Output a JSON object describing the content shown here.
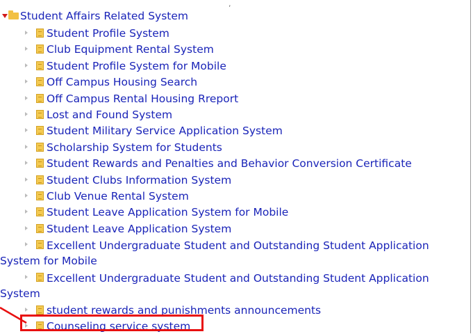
{
  "tree": {
    "root_label": "Student Affairs Related System",
    "items": [
      {
        "label": "Student Profile System"
      },
      {
        "label": "Club Equipment Rental System"
      },
      {
        "label": "Student Profile System for Mobile"
      },
      {
        "label": "Off Campus Housing Search"
      },
      {
        "label": "Off Campus Rental Housing Rreport"
      },
      {
        "label": "Lost and Found System"
      },
      {
        "label": "Student Military Service Application System"
      },
      {
        "label": "Scholarship System for Students"
      },
      {
        "label": "Student Rewards and Penalties and Behavior Conversion Certificate"
      },
      {
        "label": "Student Clubs Information System"
      },
      {
        "label": "Club Venue Rental System"
      },
      {
        "label": "Student Leave Application System for Mobile"
      },
      {
        "label": "Student Leave Application System"
      },
      {
        "label": "Excellent Undergraduate Student and Outstanding Student Application System for Mobile"
      },
      {
        "label": "Excellent Undergraduate Student and Outstanding Student Application System"
      },
      {
        "label": "student rewards and punishments announcements"
      },
      {
        "label": "Counseling service system"
      }
    ]
  },
  "colors": {
    "link": "#1a24b8",
    "highlight": "#e81010",
    "folder": "#f2c042",
    "root_arrow": "#d11a1a"
  }
}
